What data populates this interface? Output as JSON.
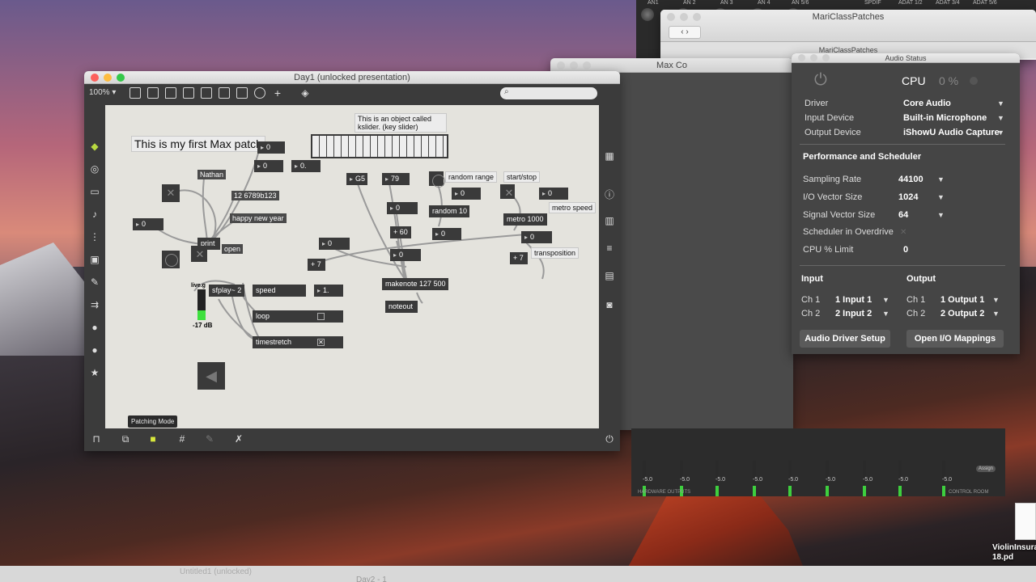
{
  "finder": {
    "title": "MariClassPatches",
    "tab": "MariClassPatches"
  },
  "console": {
    "title": "Max Co"
  },
  "patcher": {
    "title": "Day1 (unlocked presentation)",
    "zoom": "100% ▾",
    "tooltip": "Patching Mode",
    "comment_title": "This is my first Max patch",
    "comment_kslider": "This is an object called kslider. (key slider)",
    "objects": {
      "n0": "0",
      "n0b": "0",
      "n0c": "0.",
      "name": "Nathan",
      "hex": "12 6789b123",
      "happy": "happy new year",
      "n_left": "0",
      "print": "print",
      "open": "open",
      "g5": "G5",
      "n79": "79",
      "random_range": "random range",
      "startstop": "start/stop",
      "r0": "0",
      "random10": "random 10",
      "metro1000": "metro 1000",
      "metrospeed": "metro speed",
      "m0": "0",
      "n_mid": "0",
      "plus60": "+ 60",
      "p0": "0",
      "p0b": "0",
      "n_small": "0",
      "plus7a": "+ 7",
      "plus7b": "+ 7",
      "transposition": "transposition",
      "tr0": "0",
      "makenote": "makenote 127 500",
      "noteout": "noteout",
      "liveg": "live.g",
      "sfplay": "sfplay~ 2",
      "speed": "speed",
      "speedval": "1.",
      "loop": "loop",
      "timestretch": "timestretch",
      "db": "-17 dB"
    }
  },
  "audio_status": {
    "title": "Audio Status",
    "cpu_label": "CPU",
    "cpu_value": "0 %",
    "driver_label": "Driver",
    "driver": "Core Audio",
    "input_label": "Input Device",
    "input": "Built-in Microphone",
    "output_label": "Output Device",
    "output": "iShowU Audio Capture",
    "section": "Performance and Scheduler",
    "sr_label": "Sampling Rate",
    "sr": "44100",
    "iovs_label": "I/O Vector Size",
    "iovs": "1024",
    "svs_label": "Signal Vector Size",
    "svs": "64",
    "overdrive_label": "Scheduler in Overdrive",
    "cpu_limit_label": "CPU % Limit",
    "cpu_limit": "0",
    "input_hdr": "Input",
    "output_hdr": "Output",
    "in_ch1": "Ch 1",
    "in_ch1_val": "1 Input 1",
    "in_ch2": "Ch 2",
    "in_ch2_val": "2 Input 2",
    "out_ch1": "Ch 1",
    "out_ch1_val": "1 Output 1",
    "out_ch2": "Ch 2",
    "out_ch2_val": "2 Output 2",
    "setup_btn": "Audio Driver Setup",
    "mappings_btn": "Open I/O Mappings"
  },
  "mixer_top": {
    "labels": [
      "AN1",
      "AN 2",
      "AN 3",
      "AN 4",
      "AN 5/6",
      "SPDIF",
      "ADAT 1/2",
      "ADAT 3/4",
      "ADAT 5/6"
    ]
  },
  "mixer_bottom": {
    "db": "-5.0",
    "hw_label": "HARDWARE OUTPUTS",
    "cr_label": "CONTROL ROOM",
    "assign": "Assign"
  },
  "desktop": {
    "pdf_name": "ViolinInsura\n18.pd"
  },
  "bottom_windows": {
    "w1": "Untitled1 (unlocked)",
    "w2": "Day2 - 1"
  }
}
